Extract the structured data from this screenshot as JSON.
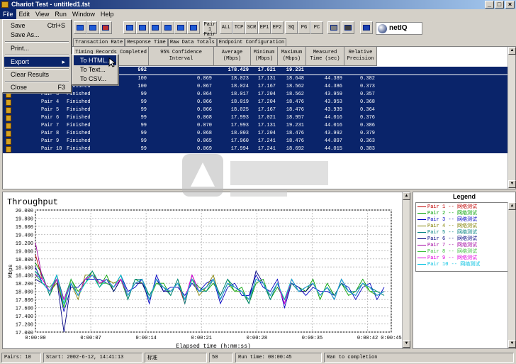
{
  "window": {
    "title": "Chariot Test - untitled1.tst",
    "min": "_",
    "max": "□",
    "close": "×"
  },
  "menubar": [
    "File",
    "Edit",
    "View",
    "Run",
    "Window",
    "Help"
  ],
  "toolbar": {
    "pair_labels": [
      "Pair 1",
      "Pair 2"
    ],
    "filters": [
      "ALL",
      "TCP",
      "SCR",
      "EP1",
      "EP2",
      "SQ",
      "PG",
      "PC"
    ],
    "logo": "netIQ"
  },
  "tabs": [
    "Transaction Rate",
    "Response Time",
    "Raw Data Totals",
    "Endpoint Configuration"
  ],
  "table": {
    "headers": [
      "Timing Records Completed",
      "95% Confidence Interval",
      "Average (Mbps)",
      "Minimum (Mbps)",
      "Maximum (Mbps)",
      "Measured Time (sec)",
      "Relative Precision"
    ],
    "total": {
      "records": "992",
      "average": "178.429",
      "minimum": "17.021",
      "maximum": "19.231"
    },
    "rows": [
      {
        "name": "",
        "status": "",
        "records": "100",
        "ci": "0.069",
        "avg": "18.023",
        "min": "17.131",
        "max": "18.648",
        "time": "44.389",
        "prec": "0.382"
      },
      {
        "name": "",
        "status": "Finished",
        "records": "100",
        "ci": "0.067",
        "avg": "18.024",
        "min": "17.167",
        "max": "18.562",
        "time": "44.386",
        "prec": "0.373"
      },
      {
        "name": "Pair 3",
        "status": "Finished",
        "records": "99",
        "ci": "0.064",
        "avg": "18.017",
        "min": "17.204",
        "max": "18.562",
        "time": "43.959",
        "prec": "0.357"
      },
      {
        "name": "Pair 4",
        "status": "Finished",
        "records": "99",
        "ci": "0.066",
        "avg": "18.019",
        "min": "17.204",
        "max": "18.476",
        "time": "43.953",
        "prec": "0.368"
      },
      {
        "name": "Pair 5",
        "status": "Finished",
        "records": "99",
        "ci": "0.066",
        "avg": "18.025",
        "min": "17.167",
        "max": "18.476",
        "time": "43.939",
        "prec": "0.364"
      },
      {
        "name": "Pair 6",
        "status": "Finished",
        "records": "99",
        "ci": "0.068",
        "avg": "17.993",
        "min": "17.021",
        "max": "18.957",
        "time": "44.016",
        "prec": "0.376"
      },
      {
        "name": "Pair 7",
        "status": "Finished",
        "records": "99",
        "ci": "0.070",
        "avg": "17.993",
        "min": "17.131",
        "max": "19.231",
        "time": "44.016",
        "prec": "0.386"
      },
      {
        "name": "Pair 8",
        "status": "Finished",
        "records": "99",
        "ci": "0.068",
        "avg": "18.003",
        "min": "17.204",
        "max": "18.476",
        "time": "43.992",
        "prec": "0.379"
      },
      {
        "name": "Pair 9",
        "status": "Finished",
        "records": "99",
        "ci": "0.065",
        "avg": "17.960",
        "min": "17.241",
        "max": "18.476",
        "time": "44.097",
        "prec": "0.363"
      },
      {
        "name": "Pair 10",
        "status": "Finished",
        "records": "99",
        "ci": "0.069",
        "avg": "17.994",
        "min": "17.241",
        "max": "18.692",
        "time": "44.015",
        "prec": "0.383"
      }
    ]
  },
  "file_menu": {
    "items": [
      {
        "label": "Save",
        "accel": "Ctrl+S"
      },
      {
        "label": "Save As...",
        "accel": ""
      },
      {
        "label": "Print...",
        "accel": ""
      },
      {
        "label": "Export",
        "accel": "▸"
      },
      {
        "label": "Clear Results",
        "accel": ""
      },
      {
        "label": "Close",
        "accel": "F3"
      }
    ]
  },
  "export_submenu": [
    "To HTML...",
    "To Text...",
    "To CSV..."
  ],
  "legend": {
    "title": "Legend",
    "items": [
      {
        "label": "Pair 1 -- 网络测试",
        "color": "#c00000"
      },
      {
        "label": "Pair 2 -- 网络测试",
        "color": "#00a000"
      },
      {
        "label": "Pair 3 -- 网络测试",
        "color": "#0000c0"
      },
      {
        "label": "Pair 4 -- 网络测试",
        "color": "#808000"
      },
      {
        "label": "Pair 5 -- 网络测试",
        "color": "#008080"
      },
      {
        "label": "Pair 6 -- 网络测试",
        "color": "#000080"
      },
      {
        "label": "Pair 7 -- 网络测试",
        "color": "#a000a0"
      },
      {
        "label": "Pair 8 -- 网络测试",
        "color": "#40c040"
      },
      {
        "label": "Pair 9 -- 网络测试",
        "color": "#e000e0"
      },
      {
        "label": "Pair 10 -- 网络测试",
        "color": "#00c0e0"
      }
    ]
  },
  "status": {
    "pairs": "Pairs: 10",
    "start": "Start: 2002-6-12, 14:41:13",
    "ime": "标准",
    "count": "50",
    "runtime": "Run time: 00:00:45",
    "state": "Ran to completion"
  },
  "chart_data": {
    "type": "line",
    "title": "Throughput",
    "xlabel": "Elapsed time (h:mm:ss)",
    "ylabel": "Mbps",
    "ylim": [
      17.0,
      20.0
    ],
    "xlim": [
      0,
      45
    ],
    "yticks": [
      "20.000",
      "19.800",
      "19.600",
      "19.400",
      "19.200",
      "19.000",
      "18.800",
      "18.600",
      "18.400",
      "18.200",
      "18.000",
      "17.800",
      "17.600",
      "17.400",
      "17.200",
      "17.000"
    ],
    "xticks": [
      "0:00:00",
      "0:00:07",
      "0:00:14",
      "0:00:21",
      "0:00:28",
      "0:00:35",
      "0:00:42",
      "0:00:45"
    ],
    "grid": true,
    "x": [
      0,
      0.9,
      1.8,
      2.7,
      3.6,
      4.5,
      5.4,
      6.3,
      7.2,
      8.1,
      9.0,
      9.9,
      10.8,
      11.7,
      12.6,
      13.5,
      14.4,
      15.3,
      16.2,
      17.1,
      18.0,
      18.9,
      19.8,
      20.7,
      21.6,
      22.5,
      23.4,
      24.3,
      25.2,
      26.1,
      27.0,
      27.9,
      28.8,
      29.7,
      30.6,
      31.5,
      32.4,
      33.3,
      34.2,
      35.1,
      36.0,
      36.9,
      37.8,
      38.7,
      39.6,
      40.5,
      41.4,
      42.3,
      43.2,
      44.1
    ],
    "series": [
      {
        "name": "Pair 1 -- 网络测试",
        "values": [
          18.9,
          18.3,
          18.0,
          18.4,
          17.8,
          18.2,
          17.9,
          18.3,
          18.4,
          18.2,
          18.3,
          18.1,
          18.4,
          17.9,
          18.2,
          18.3,
          17.8,
          18.3,
          18.1,
          18.0,
          18.2,
          17.7,
          18.4,
          18.0,
          18.1,
          18.3,
          17.8,
          18.2,
          18.1,
          18.0,
          17.8,
          18.3,
          18.2,
          17.9,
          18.2,
          17.7,
          18.3,
          18.0,
          18.1,
          18.2,
          17.9,
          18.1,
          17.8,
          18.3,
          18.0,
          17.9,
          18.2,
          18.1,
          17.9,
          18.0
        ]
      },
      {
        "name": "Pair 2 -- 网络测试",
        "values": [
          18.7,
          18.4,
          17.9,
          18.3,
          17.6,
          18.3,
          18.0,
          18.2,
          18.5,
          18.1,
          18.4,
          18.0,
          18.3,
          17.8,
          18.3,
          18.2,
          17.9,
          18.2,
          18.2,
          17.9,
          18.3,
          17.8,
          18.3,
          18.1,
          18.0,
          18.2,
          17.9,
          18.3,
          18.0,
          18.1,
          17.7,
          18.2,
          18.3,
          17.8,
          18.1,
          17.8,
          18.2,
          18.1,
          18.0,
          18.3,
          17.8,
          18.2,
          17.9,
          18.2,
          17.9,
          18.0,
          18.3,
          18.0,
          18.0,
          17.9
        ]
      },
      {
        "name": "Pair 3 -- 网络测试",
        "values": [
          18.6,
          18.2,
          18.1,
          18.3,
          17.5,
          18.1,
          18.1,
          18.3,
          18.3,
          18.3,
          18.2,
          18.1,
          18.4,
          18.0,
          18.1,
          18.3,
          17.7,
          18.4,
          18.0,
          18.1,
          18.1,
          17.9,
          18.2,
          18.0,
          18.2,
          18.3,
          17.7,
          18.1,
          18.2,
          17.9,
          17.9,
          18.4,
          18.1,
          18.0,
          18.3,
          17.6,
          18.2,
          18.1,
          17.9,
          18.1,
          18.0,
          18.0,
          17.9,
          18.2,
          18.1,
          17.8,
          18.1,
          18.2,
          17.8,
          18.1
        ]
      },
      {
        "name": "Pair 4 -- 网络测试",
        "values": [
          18.5,
          18.3,
          18.0,
          18.2,
          17.7,
          18.2,
          17.8,
          18.4,
          18.4,
          18.1,
          18.3,
          18.2,
          18.3,
          17.9,
          18.2,
          18.2,
          17.8,
          18.3,
          18.1,
          18.0,
          18.2,
          17.8,
          18.3,
          17.9,
          18.1,
          18.4,
          17.8,
          18.2,
          18.0,
          18.0,
          17.8,
          18.3,
          18.2,
          17.9,
          18.2,
          17.8,
          18.3,
          18.0,
          18.0,
          18.2,
          17.9,
          18.1,
          17.8,
          18.3,
          18.0,
          17.9,
          18.2,
          18.0,
          17.9,
          18.0
        ]
      },
      {
        "name": "Pair 5 -- 网络测试",
        "values": [
          18.4,
          18.4,
          17.9,
          18.4,
          17.8,
          18.3,
          17.9,
          18.3,
          18.5,
          18.2,
          18.2,
          18.1,
          18.4,
          17.8,
          18.3,
          18.3,
          17.9,
          18.2,
          18.1,
          17.9,
          18.3,
          17.7,
          18.4,
          18.0,
          18.0,
          18.3,
          17.9,
          18.3,
          18.1,
          18.0,
          17.7,
          18.3,
          18.2,
          17.8,
          18.2,
          17.7,
          18.2,
          18.0,
          18.1,
          18.2,
          17.9,
          18.1,
          17.9,
          18.2,
          18.0,
          18.0,
          18.2,
          18.1,
          18.0,
          17.9
        ]
      },
      {
        "name": "Pair 6 -- 网络测试",
        "values": [
          18.3,
          18.2,
          18.0,
          18.3,
          17.0,
          18.2,
          17.9,
          18.3,
          18.4,
          18.2,
          18.3,
          18.0,
          18.3,
          17.9,
          18.2,
          18.2,
          17.8,
          18.3,
          18.0,
          18.0,
          18.2,
          17.8,
          18.3,
          18.0,
          18.1,
          18.3,
          17.8,
          18.2,
          18.1,
          18.0,
          17.8,
          18.5,
          18.2,
          17.9,
          18.2,
          17.7,
          18.3,
          18.0,
          18.0,
          18.2,
          17.9,
          18.1,
          17.8,
          18.3,
          18.0,
          17.9,
          18.2,
          18.1,
          17.9,
          18.0
        ]
      },
      {
        "name": "Pair 7 -- 网络测试",
        "values": [
          19.2,
          18.3,
          18.0,
          18.3,
          17.8,
          18.2,
          17.9,
          18.3,
          18.4,
          18.2,
          18.3,
          18.1,
          18.3,
          17.9,
          18.2,
          18.3,
          17.8,
          18.3,
          18.1,
          18.0,
          18.2,
          17.8,
          18.4,
          18.0,
          18.1,
          18.3,
          17.8,
          18.2,
          18.1,
          18.0,
          17.8,
          18.3,
          18.2,
          17.9,
          18.2,
          17.7,
          18.3,
          18.0,
          18.1,
          18.2,
          17.9,
          18.1,
          17.8,
          18.3,
          18.0,
          17.9,
          18.2,
          18.1,
          17.9,
          18.0
        ]
      },
      {
        "name": "Pair 8 -- 网络测试",
        "values": [
          18.4,
          18.2,
          18.1,
          18.3,
          17.7,
          18.3,
          17.9,
          18.3,
          18.4,
          18.2,
          18.2,
          18.1,
          18.4,
          17.9,
          18.2,
          18.3,
          17.8,
          18.2,
          18.1,
          18.0,
          18.2,
          17.8,
          18.3,
          18.0,
          18.1,
          18.3,
          17.8,
          18.2,
          18.0,
          18.0,
          17.8,
          18.3,
          18.2,
          17.9,
          18.2,
          17.8,
          18.3,
          18.0,
          18.1,
          18.2,
          17.9,
          18.1,
          17.8,
          18.3,
          18.0,
          17.9,
          18.2,
          18.0,
          17.9,
          18.0
        ]
      },
      {
        "name": "Pair 9 -- 网络测试",
        "values": [
          18.4,
          18.3,
          18.0,
          18.3,
          17.8,
          18.2,
          17.9,
          18.3,
          18.4,
          18.2,
          18.3,
          18.1,
          18.3,
          17.9,
          18.2,
          18.3,
          17.8,
          18.3,
          18.1,
          18.0,
          18.2,
          17.8,
          18.4,
          18.0,
          18.1,
          18.3,
          17.8,
          18.2,
          18.1,
          18.0,
          17.8,
          18.3,
          18.2,
          17.9,
          18.2,
          17.7,
          18.3,
          18.0,
          18.1,
          18.2,
          17.9,
          18.1,
          17.8,
          18.3,
          18.0,
          17.9,
          18.2,
          18.1,
          17.9,
          18.0
        ]
      },
      {
        "name": "Pair 10 -- 网络测试",
        "values": [
          18.5,
          18.2,
          18.0,
          18.4,
          17.7,
          18.2,
          17.9,
          18.2,
          18.4,
          18.1,
          18.3,
          18.1,
          18.4,
          17.9,
          18.2,
          18.3,
          17.8,
          18.3,
          18.1,
          18.0,
          18.2,
          17.8,
          18.3,
          18.0,
          18.1,
          18.3,
          17.8,
          18.2,
          18.1,
          18.0,
          17.8,
          18.3,
          18.2,
          17.9,
          18.2,
          17.8,
          18.3,
          18.0,
          18.1,
          18.2,
          17.9,
          18.1,
          17.8,
          18.3,
          18.0,
          17.9,
          18.2,
          18.1,
          17.9,
          18.0
        ]
      }
    ]
  }
}
